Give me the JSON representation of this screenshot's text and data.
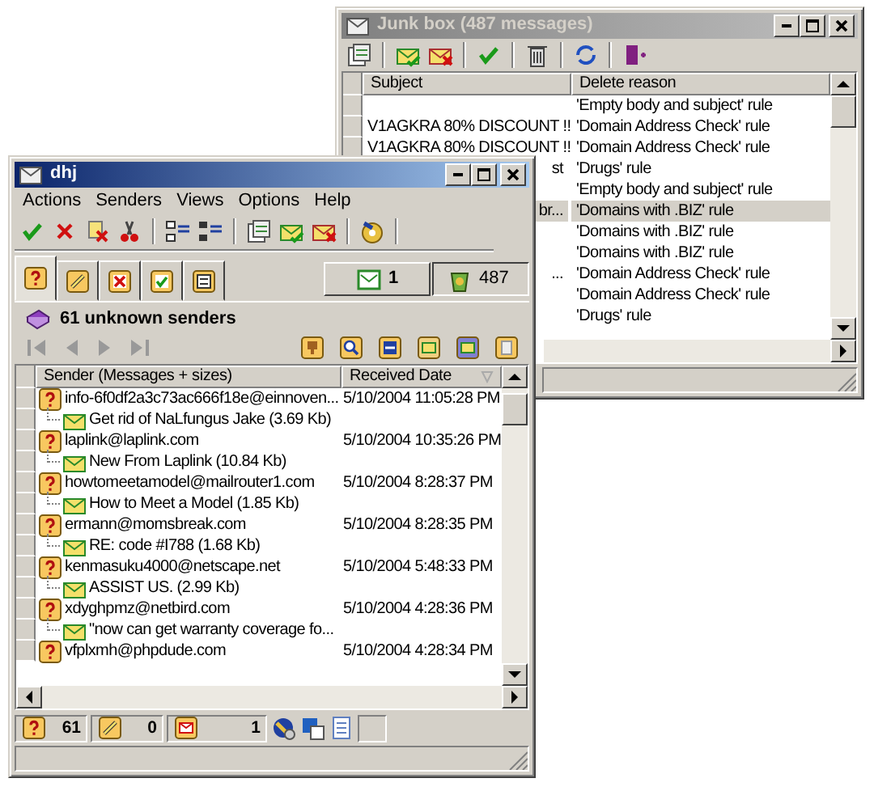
{
  "junk_window": {
    "title": "Junk box (487 messages)",
    "active": false,
    "columns": [
      "Subject",
      "Delete reason"
    ],
    "rows": [
      {
        "reason": "'Empty body and subject' rule",
        "selected": false
      },
      {
        "subject": "V1AGKRA 80% DISCOUNT !!",
        "reason": "'Domain Address Check' rule",
        "selected": false
      },
      {
        "subject": "V1AGKRA 80% DISCOUNT !!",
        "reason": "'Domain Address Check' rule",
        "selected": false
      },
      {
        "subject": "st",
        "partial": true,
        "reason": "'Drugs' rule",
        "selected": false
      },
      {
        "reason": "'Empty body and subject' rule",
        "selected": false
      },
      {
        "subject": "br...",
        "partial": true,
        "reason": "'Domains with .BIZ' rule",
        "selected": true
      },
      {
        "reason": "'Domains with .BIZ' rule",
        "selected": false
      },
      {
        "reason": "'Domains with .BIZ' rule",
        "selected": false
      },
      {
        "subject": "...",
        "partial": true,
        "reason": "'Domain Address Check' rule",
        "selected": false
      },
      {
        "reason": "'Domain Address Check' rule",
        "selected": false
      },
      {
        "reason": "'Drugs' rule",
        "selected": false
      }
    ]
  },
  "main_window": {
    "title": "dhj",
    "active": true,
    "menu": [
      "Actions",
      "Senders",
      "Views",
      "Options",
      "Help"
    ],
    "tabs": [
      {
        "selected": true
      },
      {
        "selected": false
      },
      {
        "selected": false
      },
      {
        "selected": false
      },
      {
        "selected": false
      }
    ],
    "inbox_count": "1",
    "junk_count": "487",
    "heading": "61 unknown senders",
    "columns": [
      "Sender (Messages + sizes)",
      "Received Date"
    ],
    "senders": [
      {
        "address": "info-6f0df2a3c73ac666f18e@einnoven...",
        "date": "5/10/2004 11:05:28 PM",
        "children": [
          {
            "subject": "Get rid of NaLfungus Jake (3.69 Kb)"
          }
        ]
      },
      {
        "address": "laplink@laplink.com",
        "date": "5/10/2004 10:35:26 PM",
        "children": [
          {
            "subject": "New From Laplink (10.84 Kb)"
          }
        ]
      },
      {
        "address": "howtomeetamodel@mailrouter1.com",
        "date": "5/10/2004 8:28:37 PM",
        "children": [
          {
            "subject": "How to Meet a Model (1.85 Kb)"
          }
        ]
      },
      {
        "address": "ermann@momsbreak.com",
        "date": "5/10/2004 8:28:35 PM",
        "children": [
          {
            "subject": "RE: code #I788 (1.68 Kb)"
          }
        ]
      },
      {
        "address": "kenmasuku4000@netscape.net",
        "date": "5/10/2004 5:48:33 PM",
        "children": [
          {
            "subject": "ASSIST US. (2.99 Kb)"
          }
        ]
      },
      {
        "address": "xdyghpmz@netbird.com",
        "date": "5/10/2004 4:28:36 PM",
        "children": [
          {
            "subject": "\"now can get warranty coverage fo..."
          }
        ]
      },
      {
        "address": "vfplxmh@phpdude.com",
        "date": "5/10/2004 4:28:34 PM"
      }
    ],
    "status_counts": [
      "61",
      "0",
      "1"
    ]
  }
}
